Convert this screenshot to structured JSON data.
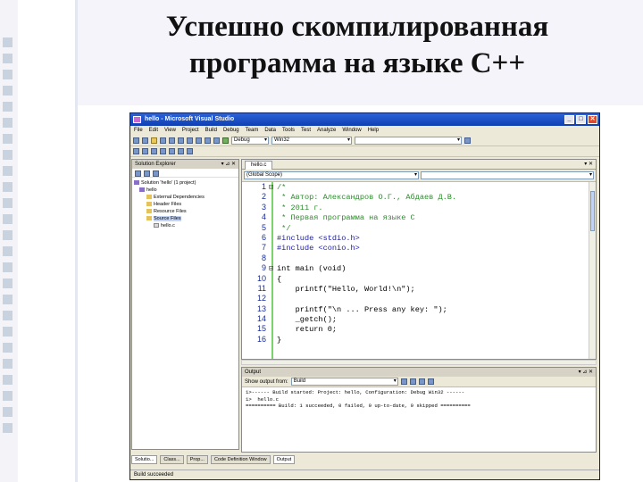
{
  "slide": {
    "title_line1": "Успешно скомпилированная",
    "title_line2": "программа на языке С++"
  },
  "window": {
    "title": "hello - Microsoft Visual Studio",
    "min": "_",
    "max": "□",
    "close": "✕"
  },
  "menu": [
    "File",
    "Edit",
    "View",
    "Project",
    "Build",
    "Debug",
    "Team",
    "Data",
    "Tools",
    "Test",
    "Analyze",
    "Window",
    "Help"
  ],
  "toolbar": {
    "config": "Debug",
    "platform": "Win32"
  },
  "solution_explorer": {
    "title": "Solution Explorer",
    "pin": "▾ ⊿ ✕",
    "items": [
      "Solution 'hello' (1 project)",
      "hello",
      "External Dependencies",
      "Header Files",
      "Resource Files",
      "Source Files",
      "hello.c"
    ]
  },
  "editor": {
    "tab": "hello.c",
    "close": "▾ ✕",
    "scope": "(Global Scope)",
    "lines": [
      {
        "n": "1",
        "fold": "⊟",
        "text": "/*",
        "cls": "cmt"
      },
      {
        "n": "2",
        "fold": "",
        "text": " * Автор: Александров О.Г., Абдаев Д.В.",
        "cls": "cmt"
      },
      {
        "n": "3",
        "fold": "",
        "text": " * 2011 г.",
        "cls": "cmt"
      },
      {
        "n": "4",
        "fold": "",
        "text": " * Первая программа на языке С",
        "cls": "cmt"
      },
      {
        "n": "5",
        "fold": "",
        "text": " */",
        "cls": "cmt"
      },
      {
        "n": "6",
        "fold": "",
        "text": "#include <stdio.h>",
        "cls": "kw"
      },
      {
        "n": "7",
        "fold": "",
        "text": "#include <conio.h>",
        "cls": "kw"
      },
      {
        "n": "8",
        "fold": "",
        "text": "",
        "cls": ""
      },
      {
        "n": "9",
        "fold": "⊟",
        "text": "int main (void)",
        "cls": ""
      },
      {
        "n": "10",
        "fold": "",
        "text": "{",
        "cls": ""
      },
      {
        "n": "11",
        "fold": "",
        "text": "    printf(\"Hello, World!\\n\");",
        "cls": ""
      },
      {
        "n": "12",
        "fold": "",
        "text": "",
        "cls": ""
      },
      {
        "n": "13",
        "fold": "",
        "text": "    printf(\"\\n ... Press any key: \");",
        "cls": ""
      },
      {
        "n": "14",
        "fold": "",
        "text": "    _getch();",
        "cls": ""
      },
      {
        "n": "15",
        "fold": "",
        "text": "    return 0;",
        "cls": ""
      },
      {
        "n": "16",
        "fold": "",
        "text": "}",
        "cls": ""
      }
    ]
  },
  "output": {
    "title": "Output",
    "pin": "▾ ⊿ ✕",
    "show_from_label": "Show output from:",
    "show_from_value": "Build",
    "lines": [
      "1>------ Build started: Project: hello, Configuration: Debug Win32 ------",
      "1>  hello.c",
      "========== Build: 1 succeeded, 0 failed, 0 up-to-date, 0 skipped =========="
    ]
  },
  "bottom_tabs": [
    "Solutio...",
    "Class...",
    "Prop...",
    "Code Definition Window",
    "Output"
  ],
  "status": "Build succeeded"
}
